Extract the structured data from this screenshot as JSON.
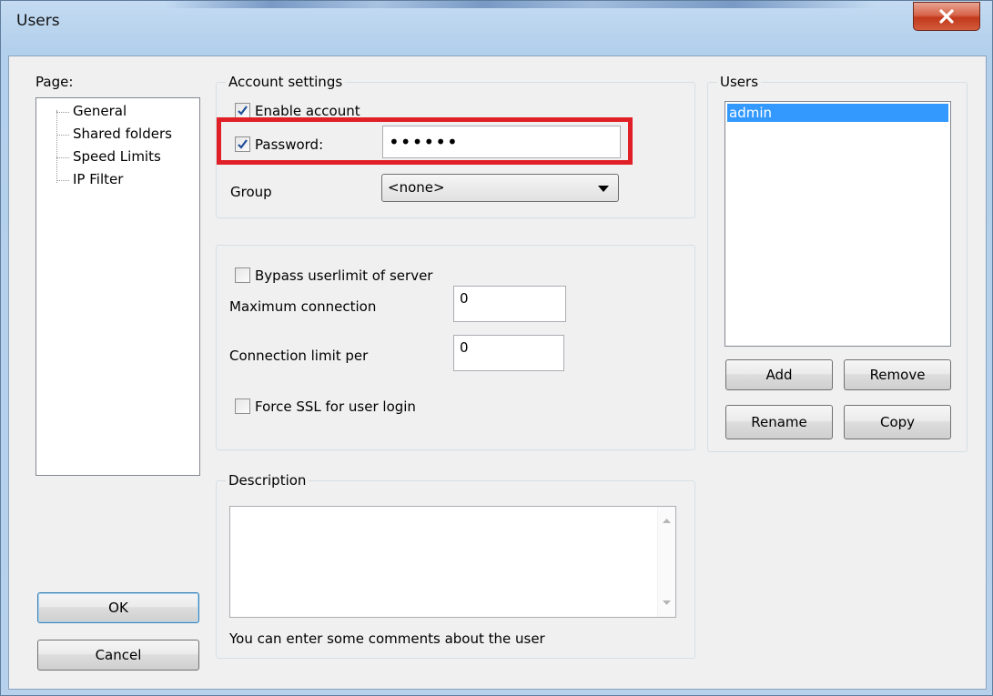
{
  "window": {
    "title": "Users",
    "close_glyph": "X"
  },
  "page_panel": {
    "label": "Page:",
    "items": [
      "General",
      "Shared folders",
      "Speed Limits",
      "IP Filter"
    ],
    "selected": "General"
  },
  "account_settings": {
    "caption": "Account settings",
    "enable_account": {
      "label": "Enable account",
      "checked": true
    },
    "password": {
      "label": "Password:",
      "checked": true,
      "value": "••••••"
    },
    "group": {
      "label": "Group",
      "value": "<none>"
    }
  },
  "limits": {
    "bypass": {
      "label": "Bypass userlimit of server",
      "checked": false
    },
    "max_connection": {
      "label": "Maximum connection",
      "value": "0"
    },
    "conn_limit_per": {
      "label": "Connection limit per",
      "value": "0"
    },
    "force_ssl": {
      "label": "Force SSL for user login",
      "checked": false
    }
  },
  "description": {
    "caption": "Description",
    "value": "",
    "hint": "You can enter some comments about the user"
  },
  "users_panel": {
    "caption": "Users",
    "items": [
      "admin"
    ],
    "selected": "admin",
    "buttons": {
      "add": "Add",
      "remove": "Remove",
      "rename": "Rename",
      "copy": "Copy"
    }
  },
  "dialog_buttons": {
    "ok": "OK",
    "cancel": "Cancel"
  },
  "colors": {
    "highlight": "#e02026",
    "selection": "#3399ff",
    "close": "#c2391c"
  }
}
